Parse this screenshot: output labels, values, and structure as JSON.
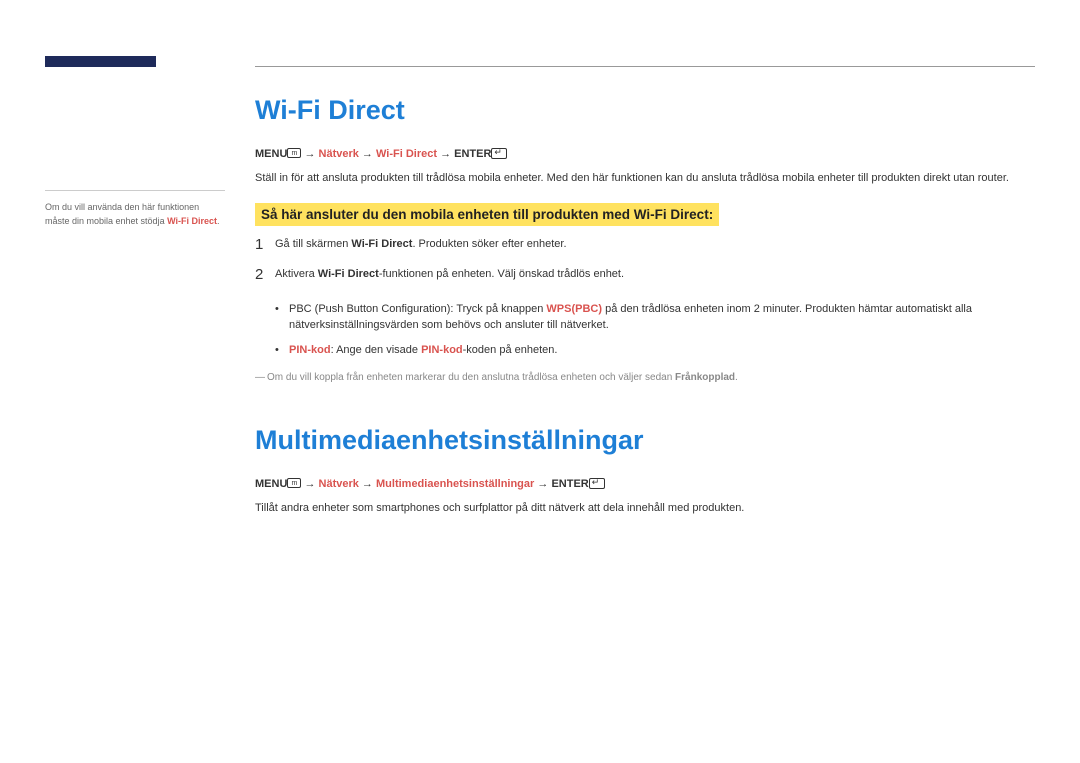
{
  "sidebar": {
    "note_prefix": "Om du vill använda den här funktionen måste din mobila enhet stödja ",
    "note_red": "Wi-Fi Direct",
    "note_suffix": "."
  },
  "section1": {
    "heading": "Wi-Fi Direct",
    "nav": {
      "menu": "MENU",
      "arrow": " → ",
      "p1": "Nätverk",
      "p2": "Wi-Fi Direct",
      "enter": "ENTER"
    },
    "desc": "Ställ in för att ansluta produkten till trådlösa mobila enheter. Med den här funktionen kan du ansluta trådlösa mobila enheter till produkten direkt utan router.",
    "highlight": "Så här ansluter du den mobila enheten till produkten med Wi-Fi Direct:",
    "step1": {
      "pre": "Gå till skärmen ",
      "bold": "Wi-Fi Direct",
      "post": ". Produkten söker efter enheter."
    },
    "step2": {
      "pre": "Aktivera ",
      "bold": "Wi-Fi Direct",
      "post": "-funktionen på enheten. Välj önskad trådlös enhet."
    },
    "bullet1": {
      "pre": "PBC (Push Button Configuration): Tryck på knappen ",
      "red": "WPS(PBC)",
      "post": " på den trådlösa enheten inom 2 minuter. Produkten hämtar automatiskt alla nätverksinställningsvärden som behövs och ansluter till nätverket."
    },
    "bullet2": {
      "red1": "PIN-kod",
      "mid": ": Ange den visade ",
      "red2": "PIN-kod",
      "post": "-koden på enheten."
    },
    "note": {
      "pre": "Om du vill koppla från enheten markerar du den anslutna trådlösa enheten och väljer sedan ",
      "bold": "Frånkopplad",
      "post": "."
    }
  },
  "section2": {
    "heading": "Multimediaenhetsinställningar",
    "nav": {
      "menu": "MENU",
      "arrow": " → ",
      "p1": "Nätverk",
      "p2": "Multimediaenhetsinställningar",
      "enter": "ENTER"
    },
    "desc": "Tillåt andra enheter som smartphones och surfplattor på ditt nätverk att dela innehåll med produkten."
  }
}
